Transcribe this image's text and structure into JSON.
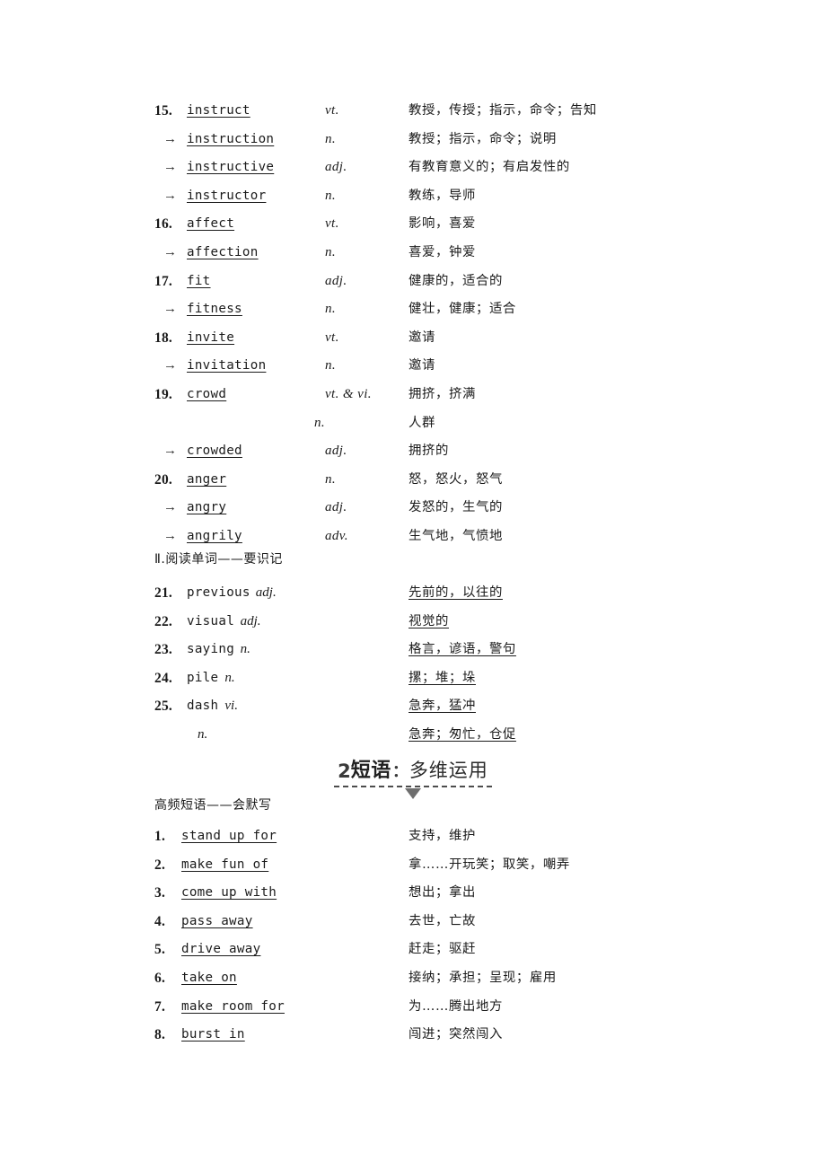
{
  "vocab_section": {
    "rows": [
      {
        "num": "15.",
        "arrow": "",
        "word": "instruct",
        "underline_word": true,
        "pos": "vt.",
        "def": "教授，传授；指示，命令；告知",
        "underline_def": false
      },
      {
        "num": "",
        "arrow": "→",
        "word": "instruction",
        "underline_word": true,
        "pos": "n.",
        "def": "教授；指示，命令；说明",
        "underline_def": false
      },
      {
        "num": "",
        "arrow": "→",
        "word": "instructive",
        "underline_word": true,
        "pos": "adj.",
        "def": "有教育意义的；有启发性的",
        "underline_def": false
      },
      {
        "num": "",
        "arrow": "→",
        "word": "instructor",
        "underline_word": true,
        "pos": "n.",
        "def": "教练，导师",
        "underline_def": false
      },
      {
        "num": "16.",
        "arrow": "",
        "word": "affect",
        "underline_word": true,
        "pos": "vt.",
        "def": "影响，喜爱",
        "underline_def": false
      },
      {
        "num": "",
        "arrow": "→",
        "word": "affection",
        "underline_word": true,
        "pos": "n.",
        "def": "喜爱，钟爱",
        "underline_def": false
      },
      {
        "num": "17.",
        "arrow": "",
        "word": "fit",
        "underline_word": true,
        "pos": "adj.",
        "def": "健康的，适合的",
        "underline_def": false
      },
      {
        "num": "",
        "arrow": "→",
        "word": "fitness",
        "underline_word": true,
        "pos": "n.",
        "def": "健壮，健康；适合",
        "underline_def": false
      },
      {
        "num": "18.",
        "arrow": "",
        "word": "invite",
        "underline_word": true,
        "pos": "vt.",
        "def": "邀请",
        "underline_def": false
      },
      {
        "num": "",
        "arrow": "→",
        "word": "invitation",
        "underline_word": true,
        "pos": "n.",
        "def": "邀请",
        "underline_def": false
      },
      {
        "num": "19.",
        "arrow": "",
        "word": "crowd",
        "underline_word": true,
        "pos": "vt. & vi.",
        "def": "拥挤，挤满",
        "underline_def": false
      },
      {
        "num": "",
        "arrow": "",
        "word": "",
        "underline_word": false,
        "pos": "n.",
        "pos_shift": true,
        "def": "人群",
        "underline_def": false
      },
      {
        "num": "",
        "arrow": "→",
        "word": "crowded",
        "underline_word": true,
        "pos": "adj.",
        "def": "拥挤的",
        "underline_def": false
      },
      {
        "num": "20.",
        "arrow": "",
        "word": "anger",
        "underline_word": true,
        "pos": "n.",
        "def": "怒，怒火，怒气",
        "underline_def": false
      },
      {
        "num": "",
        "arrow": "→",
        "word": "angry",
        "underline_word": true,
        "pos": "adj.",
        "def": "发怒的，生气的",
        "underline_def": false
      },
      {
        "num": "",
        "arrow": "→",
        "word": "angrily",
        "underline_word": true,
        "pos": "adv.",
        "def": "生气地，气愤地",
        "underline_def": false
      }
    ]
  },
  "reading_heading": "Ⅱ.阅读单词——要识记",
  "reading_section": {
    "rows": [
      {
        "num": "21.",
        "word": "previous",
        "pos": "adj.",
        "def": "先前的，以往的"
      },
      {
        "num": "22.",
        "word": "visual",
        "pos": "adj.",
        "def": "视觉的"
      },
      {
        "num": "23.",
        "word": "saying",
        "pos": "n.",
        "def": "格言，谚语，警句"
      },
      {
        "num": "24.",
        "word": "pile",
        "pos": "n.",
        "def": "摞；堆；垛"
      },
      {
        "num": "25.",
        "word": "dash",
        "pos": "vi.",
        "def": "急奔，猛冲"
      },
      {
        "num": "",
        "word": "",
        "pos": "n.",
        "def": "急奔；匆忙，仓促"
      }
    ]
  },
  "banner": {
    "number": "2",
    "keyword": "短语",
    "colon": "：",
    "rest": "多维运用"
  },
  "phrase_heading": "高频短语——会默写",
  "phrase_section": {
    "rows": [
      {
        "num": "1.",
        "word": "stand up for",
        "def": "支持，维护"
      },
      {
        "num": "2.",
        "word": "make fun of",
        "def": "拿……开玩笑；取笑，嘲弄"
      },
      {
        "num": "3.",
        "word": "come up  with",
        "def": "想出；拿出"
      },
      {
        "num": "4.",
        "word": "pass away",
        "def": "去世，亡故"
      },
      {
        "num": "5.",
        "word": "drive away",
        "def": "赶走；驱赶"
      },
      {
        "num": "6.",
        "word": "take on",
        "def": "接纳；承担；呈现；雇用"
      },
      {
        "num": "7.",
        "word": "make room for",
        "def": "为……腾出地方"
      },
      {
        "num": "8.",
        "word": "burst in",
        "def": "闯进；突然闯入"
      }
    ]
  }
}
